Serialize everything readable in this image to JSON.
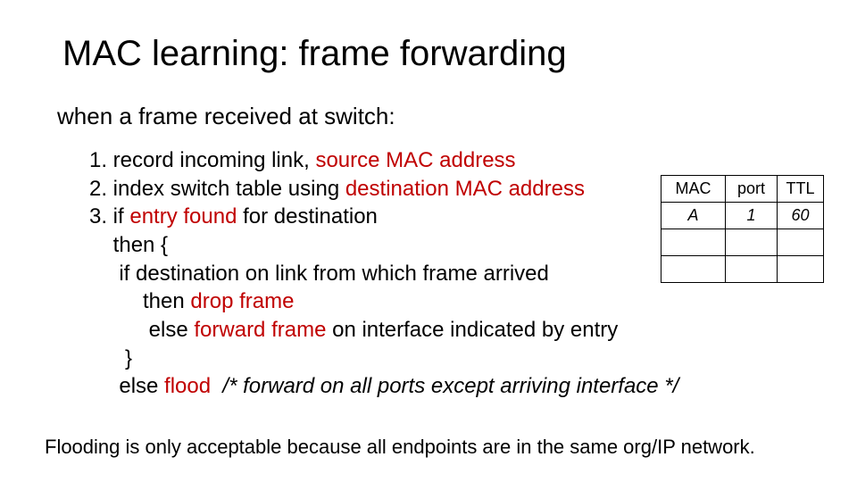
{
  "title": "MAC learning: frame forwarding",
  "subtitle": "when a frame received at switch:",
  "body": {
    "l1a": "1. record incoming link, ",
    "l1b": "source MAC address",
    "l2a": "2. index switch table using ",
    "l2b": "destination MAC address",
    "l3a": "3. if ",
    "l3b": "entry found",
    "l3c": " for destination",
    "l4": "    then {",
    "l5": "     if destination on link from which frame arrived",
    "l6a": "         then ",
    "l6b": "drop frame",
    "l7a": "          else ",
    "l7b": "forward frame",
    "l7c": " on interface indicated by entry",
    "l8": "      }",
    "l9a": "     else ",
    "l9b": "flood",
    "l9c": "  /* forward on all ports except arriving interface */"
  },
  "table": {
    "headers": [
      "MAC",
      "port",
      "TTL"
    ],
    "rows": [
      [
        "A",
        "1",
        "60"
      ]
    ]
  },
  "footer": "Flooding is only acceptable because all endpoints are in the same org/IP network."
}
